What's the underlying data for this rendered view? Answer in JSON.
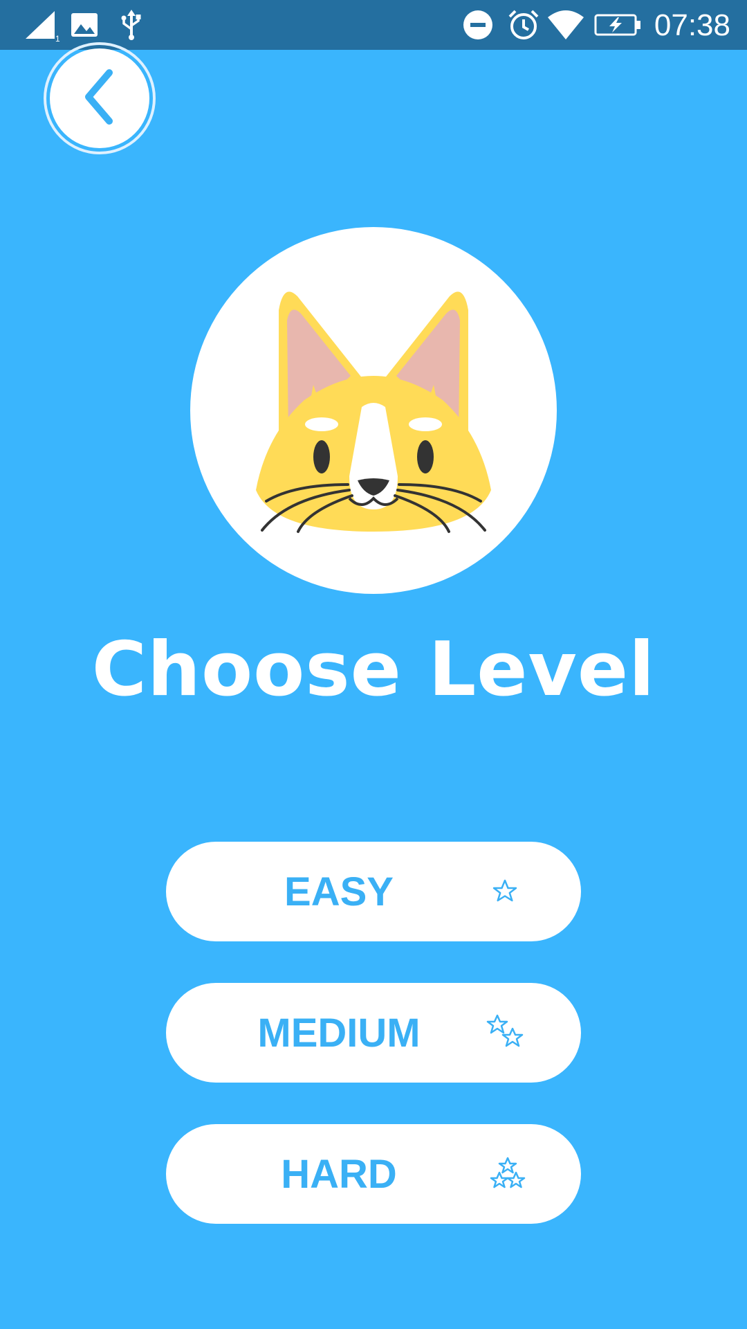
{
  "status_bar": {
    "time": "07:38",
    "icons": [
      "signal-icon",
      "image-notification-icon",
      "usb-icon",
      "do-not-disturb-icon",
      "alarm-icon",
      "wifi-icon",
      "battery-charging-icon"
    ]
  },
  "header": {
    "back_icon": "chevron-left-icon"
  },
  "main": {
    "mascot": "cat-face-icon",
    "title": "Choose Level",
    "levels": [
      {
        "label": "EASY",
        "stars": 1
      },
      {
        "label": "MEDIUM",
        "stars": 2
      },
      {
        "label": "HARD",
        "stars": 3
      }
    ]
  },
  "colors": {
    "background": "#3ab5fd",
    "status_bar": "#246fa0",
    "accent": "#3ab0f5",
    "button_bg": "#ffffff",
    "mascot_yellow": "#ffdb57"
  }
}
